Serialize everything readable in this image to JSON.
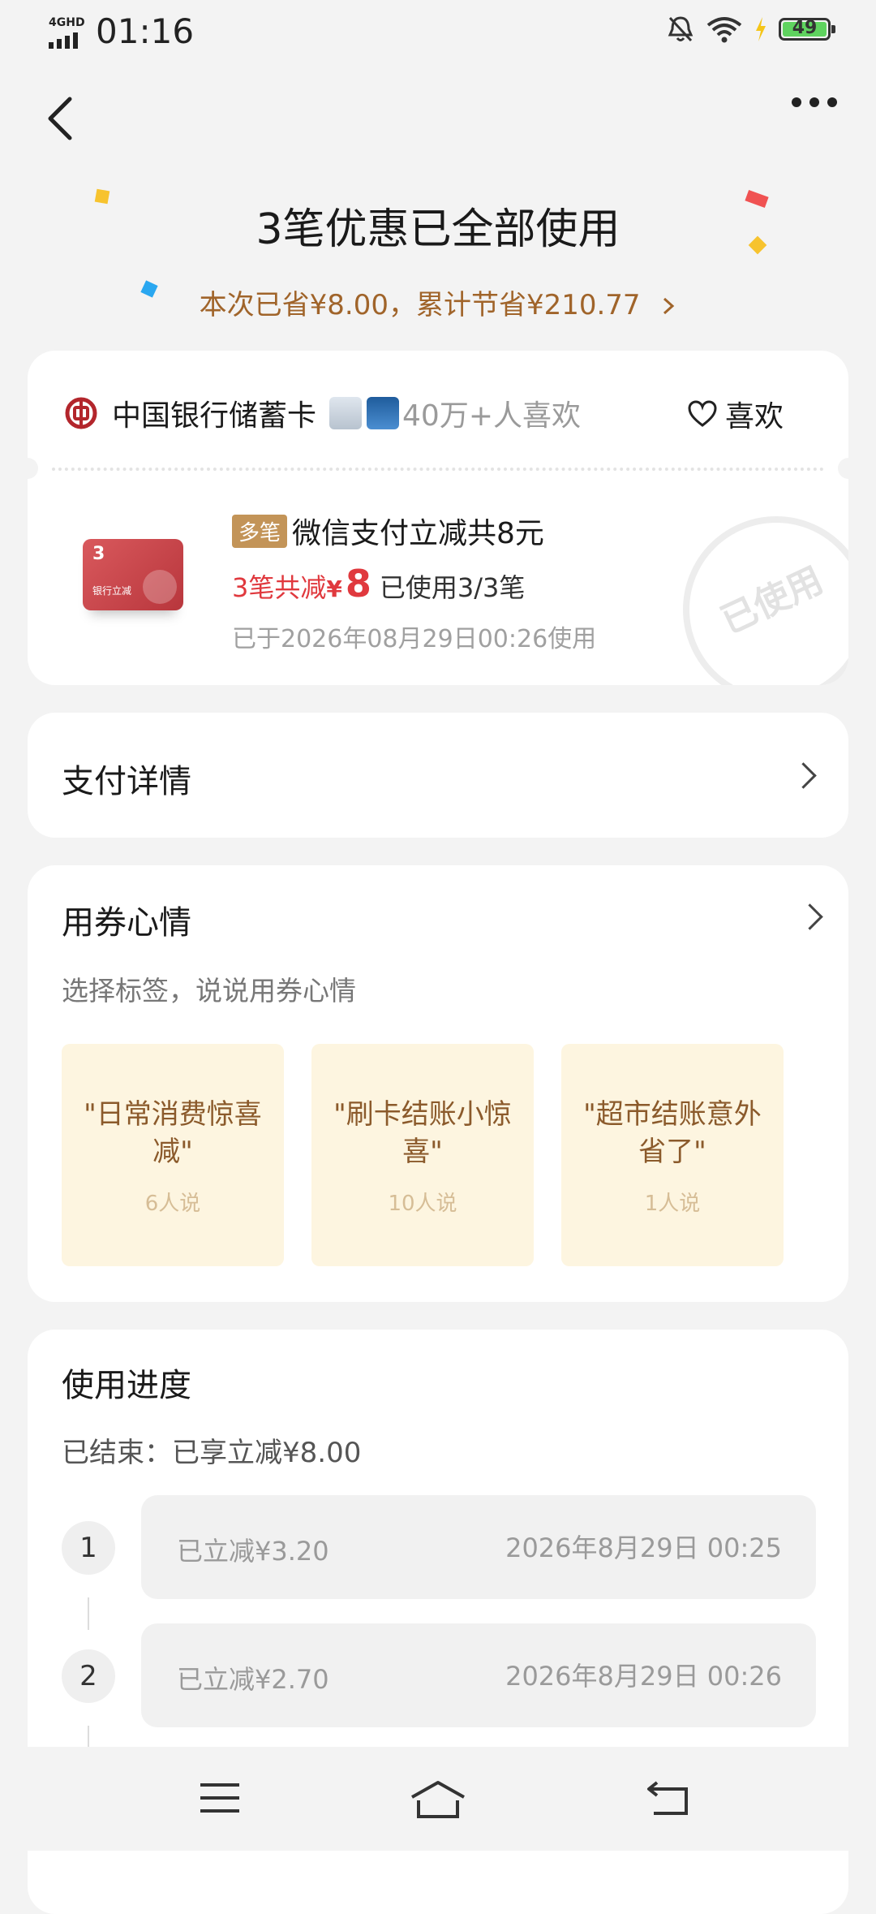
{
  "status_bar": {
    "network": "4GHD",
    "time": "01:16",
    "battery": "49"
  },
  "header": {
    "title": "3笔优惠已全部使用",
    "subtitle": "本次已省¥8.00，累计节省¥210.77",
    "back_icon": "back-chevron-icon",
    "more_icon": "more-dots-icon"
  },
  "coupon": {
    "bank_name": "中国银行储蓄卡",
    "likes_text": "40万+人喜欢",
    "like_label": "喜欢",
    "tag": "多笔",
    "title": "微信支付立减共8元",
    "card_count": "3",
    "card_sub": "银行立减",
    "total_prefix": "3笔共减",
    "currency": "¥",
    "amount": "8",
    "used_text": "已使用3/3笔",
    "used_date": "已于2026年08月29日00:26使用",
    "stamp": "已使用"
  },
  "pay_details": {
    "label": "支付详情"
  },
  "mood": {
    "title": "用券心情",
    "hint": "选择标签，说说用券心情",
    "tiles": [
      {
        "text": "\"日常消费惊喜减\"",
        "count": "6人说"
      },
      {
        "text": "\"刷卡结账小惊喜\"",
        "count": "10人说"
      },
      {
        "text": "\"超市结账意外省了\"",
        "count": "1人说"
      }
    ]
  },
  "progress": {
    "title": "使用进度",
    "summary": "已结束：已享立减¥8.00",
    "steps": [
      {
        "num": "1",
        "label": "已立减¥3.20",
        "time": "2026年8月29日 00:25"
      },
      {
        "num": "2",
        "label": "已立减¥2.70",
        "time": "2026年8月29日 00:26"
      }
    ]
  },
  "nav": {
    "icons": [
      "menu-icon",
      "home-icon",
      "return-icon"
    ]
  },
  "colors": {
    "accent_brown": "#a0642a",
    "red": "#e0393e",
    "tag_gold": "#c39458",
    "tile_bg": "#fdf5e0"
  }
}
